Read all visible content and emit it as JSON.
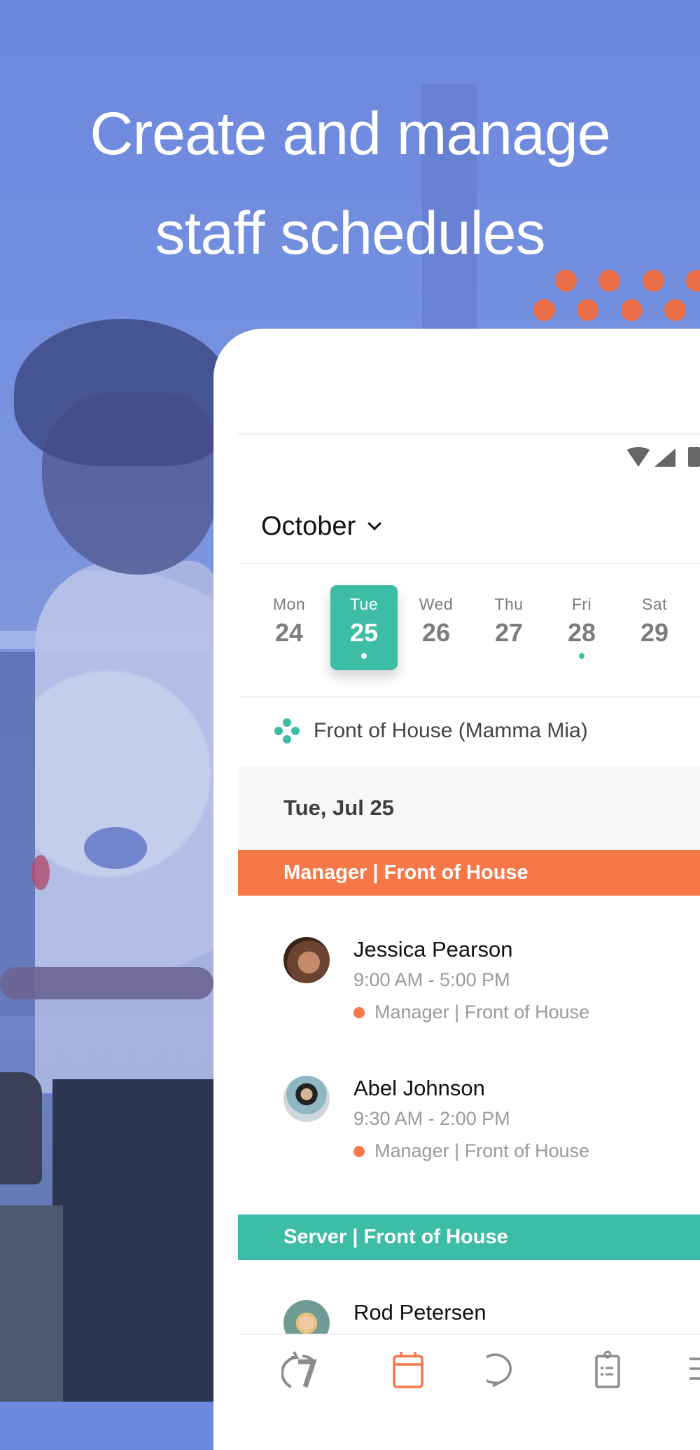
{
  "headline": {
    "line1": "Create and manage",
    "line2": "staff schedules"
  },
  "colors": {
    "background": "#6f89dd",
    "accent_orange": "#f67848",
    "accent_teal": "#3dbda5",
    "decor_dots": "#e96e47"
  },
  "app": {
    "status_bar": {
      "icons": [
        "wifi-icon",
        "signal-icon",
        "battery-icon"
      ]
    },
    "month_selector": {
      "label": "October",
      "icon": "chevron-down-icon"
    },
    "days": [
      {
        "name": "Mon",
        "number": "24",
        "selected": false,
        "has_event": false
      },
      {
        "name": "Tue",
        "number": "25",
        "selected": true,
        "has_event": true
      },
      {
        "name": "Wed",
        "number": "26",
        "selected": false,
        "has_event": false
      },
      {
        "name": "Thu",
        "number": "27",
        "selected": false,
        "has_event": false
      },
      {
        "name": "Fri",
        "number": "28",
        "selected": false,
        "has_event": true
      },
      {
        "name": "Sat",
        "number": "29",
        "selected": false,
        "has_event": false
      }
    ],
    "group": {
      "icon": "group-dots-icon",
      "label": "Front of House (Mamma Mia)"
    },
    "date_header": "Tue, Jul 25",
    "sections": [
      {
        "title": "Manager | Front of House",
        "color": "#f67848",
        "shifts": [
          {
            "name": "Jessica Pearson",
            "time": "9:00 AM - 5:00 PM",
            "role": "Manager | Front of House"
          },
          {
            "name": "Abel Johnson",
            "time": "9:30 AM - 2:00 PM",
            "role": "Manager | Front of House"
          }
        ]
      },
      {
        "title": "Server | Front of House",
        "color": "#3dbda5",
        "shifts": [
          {
            "name": "Rod Petersen"
          }
        ]
      }
    ],
    "bottom_nav": [
      {
        "icon": "timeclock-icon",
        "active": false
      },
      {
        "icon": "calendar-icon",
        "active": true
      },
      {
        "icon": "chat-icon",
        "active": false
      },
      {
        "icon": "clipboard-icon",
        "active": false
      },
      {
        "icon": "menu-icon",
        "active": false
      }
    ]
  }
}
